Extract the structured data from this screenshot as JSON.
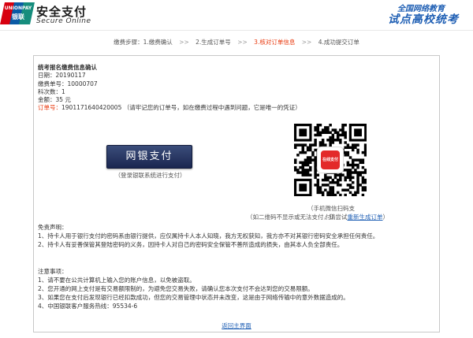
{
  "header": {
    "logo_en": "UNIONPAY",
    "logo_cn": "银联",
    "brand_cn": "安全支付",
    "brand_en": "Secure Online",
    "slogan_top": "全国网络教育",
    "slogan_main": "试点高校统考"
  },
  "steps": {
    "items": [
      {
        "label": "缴费步骤：1.缴费确认",
        "active": false
      },
      {
        "label": "2.生成订单号",
        "active": false
      },
      {
        "label": "3.核对订单信息",
        "active": true
      },
      {
        "label": "4.成功提交订单",
        "active": false
      }
    ],
    "separator": ">>"
  },
  "info": {
    "title": "统考报名缴费信息确认",
    "date": "日期：20190117",
    "fee_no": "缴费单号：10000707",
    "subject_count": "科次数：1",
    "amount": "金额：35 元",
    "order_label": "订单号：",
    "order_no": "1901171640420005",
    "order_note": "（请牢记您的订单号，如在缴费过程中遇到问题，它是唯一的凭证）"
  },
  "pay": {
    "button_label": "网银支付",
    "note": "（登录银联系统进行支付）"
  },
  "qr": {
    "logo_text": "在线支付",
    "caption": "（手机微信扫码支付）",
    "hint_prefix": "（如二维码不显示或无法支付，请尝试",
    "hint_link": "重新生成订单",
    "hint_suffix": "）"
  },
  "disclaimer": {
    "title": "免责声明：",
    "items": [
      "1、持卡人用于银行支付的密码系由银行提供，应仅属持卡人本人知晓，我方无权获知，我方亦不对其银行密码安全承担任何责任。",
      "2、持卡人有妥善保管其登陆密码的义务，因持卡人对自己的密码安全保管不善所造成的损失，由其本人负全部责任。"
    ]
  },
  "notes": {
    "title": "注意事项：",
    "items": [
      "1、请不要在公共计算机上输入您的账户信息，以免被盗取。",
      "2、您开通的网上支付是有交易额限制的，为避免您交易失败，请确认您本次支付不会达到您的交易限额。",
      "3、如果您在支付后发现银行已经扣款成功，但您的交易管理中状态并未改变，这是由于网络传输中的意外数据造成的。",
      "4、中国银联客户服务热线：95534-6"
    ]
  },
  "footer": {
    "back_link": "返回主界面"
  },
  "colors": {
    "accent": "#e8380d",
    "link": "#1f5fb4",
    "button": "#1a2650"
  }
}
